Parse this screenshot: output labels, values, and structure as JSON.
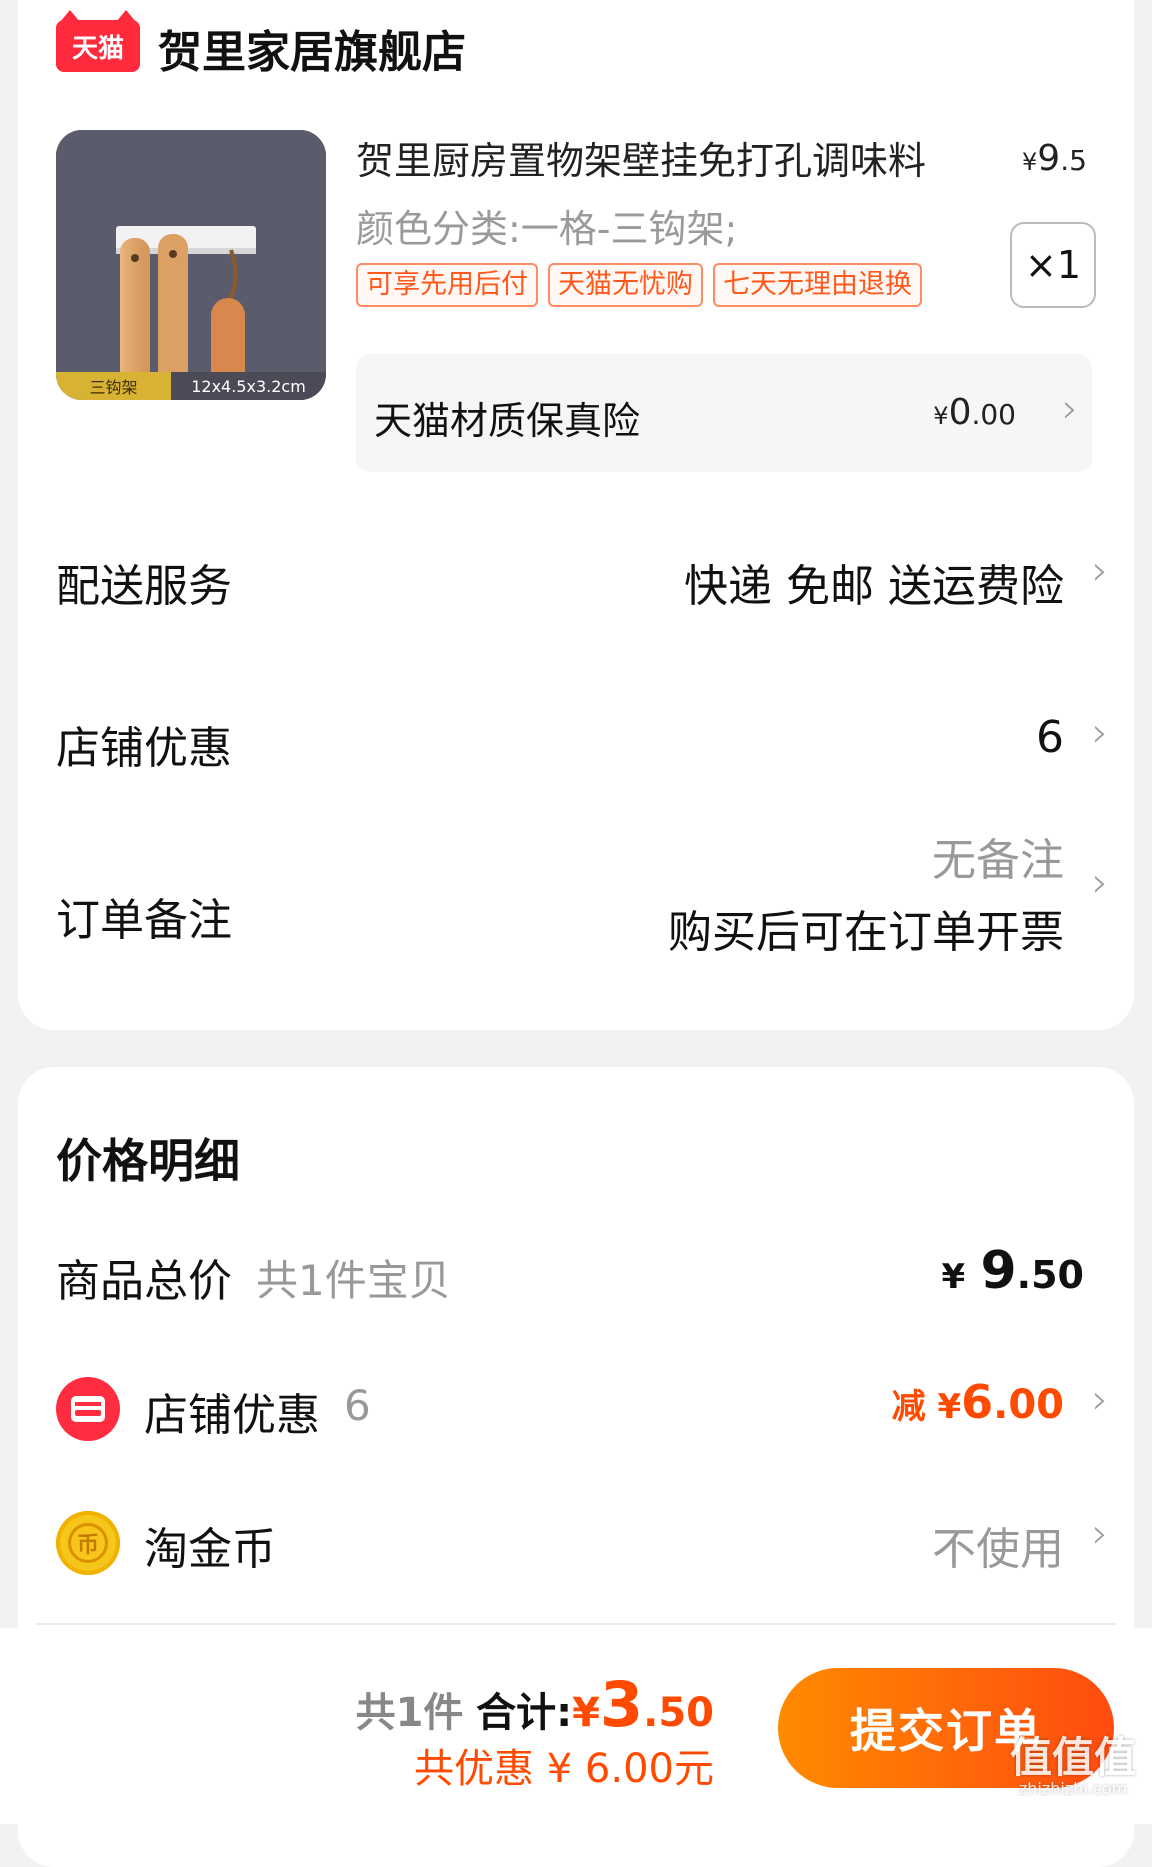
{
  "store": {
    "logo_text": "天猫",
    "name": "贺里家居旗舰店"
  },
  "product": {
    "title": "贺里厨房置物架壁挂免打孔调味料",
    "price_symbol": "¥",
    "price_int": "9",
    "price_dec": ".5",
    "spec": "颜色分类:一格-三钩架;",
    "tags": [
      "可享先用后付",
      "天猫无忧购",
      "七天无理由退换"
    ],
    "quantity": "×1",
    "image_caption_left": "三钩架",
    "image_caption_right": "12x4.5x3.2cm"
  },
  "insurance": {
    "label": "天猫材质保真险",
    "price_symbol": "¥",
    "price_int": "0",
    "price_dec": ".00"
  },
  "delivery": {
    "label": "配送服务",
    "value": "快递 免邮 送运费险"
  },
  "shop_discount": {
    "label": "店铺优惠",
    "value": "6"
  },
  "order_note": {
    "label": "订单备注",
    "value_line1": "无备注",
    "value_line2": "购买后可在订单开票"
  },
  "price_detail": {
    "title": "价格明细",
    "goods_label": "商品总价",
    "goods_sub": "共1件宝贝",
    "goods_price_symbol": "¥",
    "goods_price_int": "9",
    "goods_price_dec": ".50",
    "shop_discount_label": "店铺优惠",
    "shop_discount_count": "6",
    "shop_discount_prefix": "减 ¥",
    "shop_discount_int": "6",
    "shop_discount_dec": ".00",
    "coin_label": "淘金币",
    "coin_value": "不使用",
    "coin_icon_glyph": "币"
  },
  "bottom": {
    "count_text": "共1件",
    "total_label": "合计:",
    "total_symbol": "¥",
    "total_int": "3",
    "total_dec": ".50",
    "saved_text": "共优惠 ¥ 6.00元",
    "submit_label": "提交订单"
  },
  "watermark": {
    "text": "值值值",
    "url": "zhizhizhi.com"
  },
  "colors": {
    "accent": "#ff4a00",
    "tmall_red": "#ff2a3c",
    "button_gradient_start": "#ff8a00",
    "button_gradient_end": "#ff4b10"
  },
  "icons": {
    "chevron": "chevron-right-icon",
    "shop": "shop-discount-icon",
    "coin": "taojinbi-coin-icon",
    "logo": "tmall-logo-icon"
  }
}
